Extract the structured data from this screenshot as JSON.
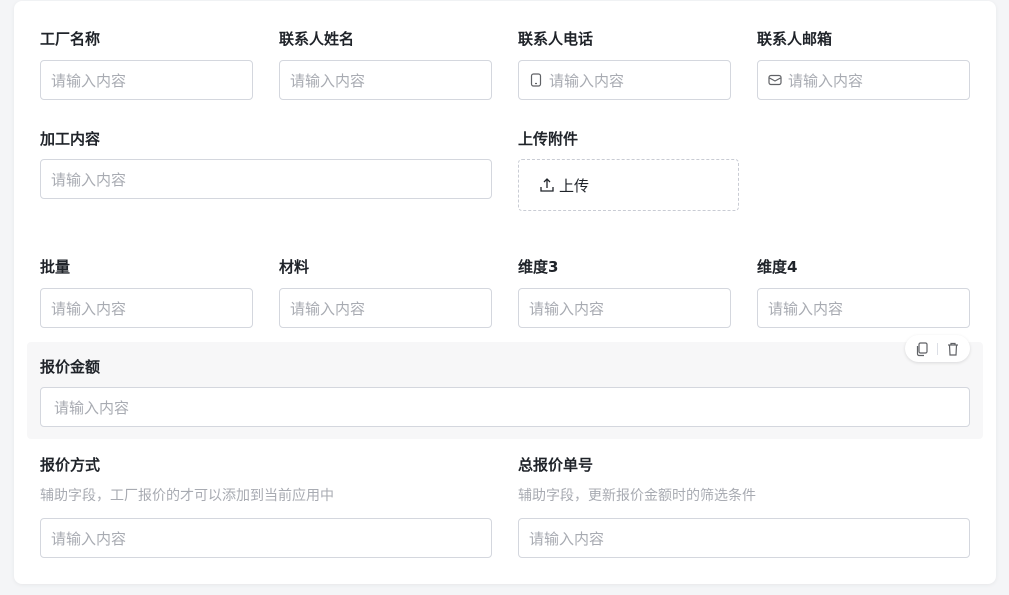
{
  "form": {
    "factory_name": {
      "label": "工厂名称",
      "placeholder": "请输入内容"
    },
    "contact_name": {
      "label": "联系人姓名",
      "placeholder": "请输入内容"
    },
    "contact_phone": {
      "label": "联系人电话",
      "placeholder": "请输入内容",
      "icon": "phone-icon"
    },
    "contact_email": {
      "label": "联系人邮箱",
      "placeholder": "请输入内容",
      "icon": "mail-icon"
    },
    "processing": {
      "label": "加工内容",
      "placeholder": "请输入内容"
    },
    "attachment": {
      "label": "上传附件",
      "button": "上传",
      "icon": "upload-icon"
    },
    "batch": {
      "label": "批量",
      "placeholder": "请输入内容"
    },
    "material": {
      "label": "材料",
      "placeholder": "请输入内容"
    },
    "dim3": {
      "label": "维度3",
      "placeholder": "请输入内容"
    },
    "dim4": {
      "label": "维度4",
      "placeholder": "请输入内容"
    },
    "quote_amount": {
      "label": "报价金额",
      "placeholder": "请输入内容"
    },
    "quote_method": {
      "label": "报价方式",
      "hint": "辅助字段，工厂报价的才可以添加到当前应用中",
      "placeholder": "请输入内容"
    },
    "total_quote_no": {
      "label": "总报价单号",
      "hint": "辅助字段，更新报价金额时的筛选条件",
      "placeholder": "请输入内容"
    }
  },
  "toolbar": {
    "copy_icon": "copy-icon",
    "delete_icon": "trash-icon"
  },
  "colors": {
    "placeholder": "#a8abb2",
    "border": "#d4d7de",
    "label": "#1f2329",
    "selected_bg": "#f7f7f8"
  }
}
